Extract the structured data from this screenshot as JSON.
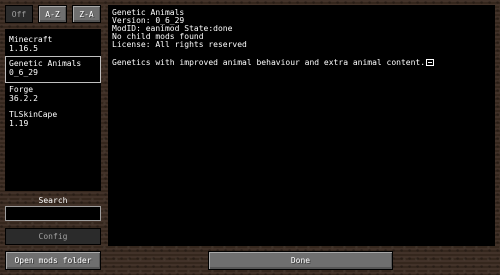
{
  "sort_buttons": {
    "off": "Off",
    "az": "A-Z",
    "za": "Z-A"
  },
  "mod_list": [
    {
      "name": "Minecraft",
      "version": "1.16.5"
    },
    {
      "name": "Genetic Animals",
      "version": "0_6_29",
      "selected": true
    },
    {
      "name": "Forge",
      "version": "36.2.2"
    },
    {
      "name": "TLSkinCape",
      "version": "1.19"
    }
  ],
  "search": {
    "label": "Search",
    "value": ""
  },
  "config_button": "Config",
  "open_mods_button": "Open mods folder",
  "done_button": "Done",
  "info": {
    "title": "Genetic Animals",
    "version": "Version: 0_6_29",
    "mod_state": "ModID: eanimod State:done",
    "child_mods": "No child mods found",
    "license": "License: All rights reserved",
    "description": "Genetics with improved animal behaviour and extra animal content."
  }
}
